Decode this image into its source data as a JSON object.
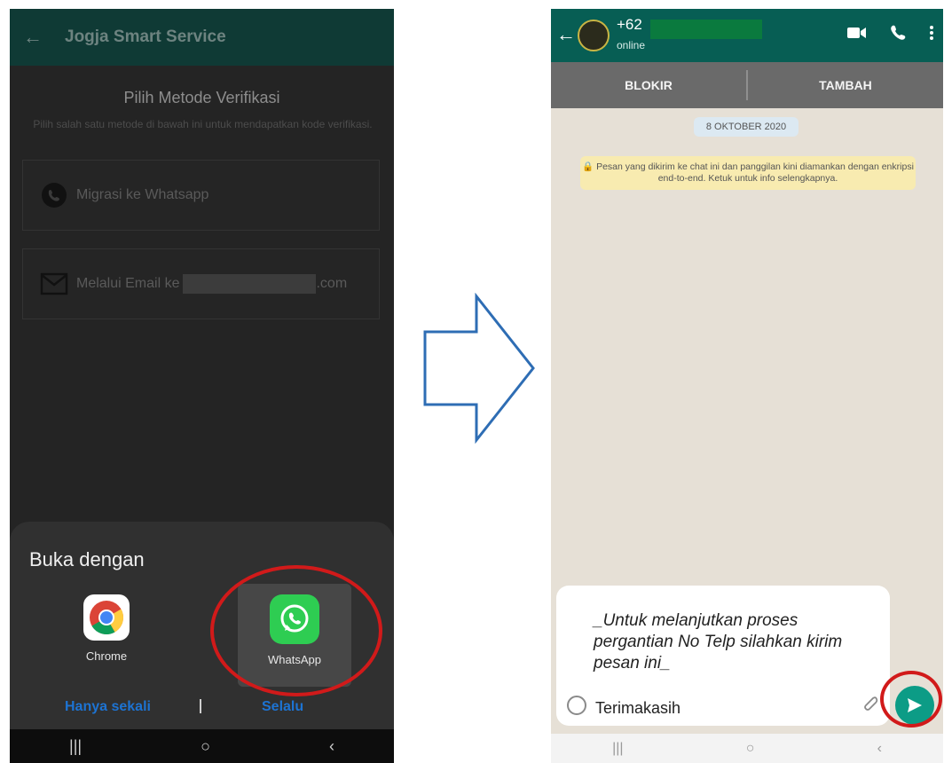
{
  "left_screen": {
    "app_title": "Jogja Smart Service",
    "heading": "Pilih Metode Verifikasi",
    "subheading": "Pilih salah satu metode di bawah ini untuk mendapatkan kode verifikasi.",
    "options": [
      {
        "label": "Migrasi ke Whatsapp",
        "icon": "whatsapp-icon"
      },
      {
        "label": "Melalui Email ke",
        "suffix": ".com",
        "icon": "mail-icon"
      }
    ],
    "sheet": {
      "title": "Buka dengan",
      "apps": [
        {
          "label": "Chrome",
          "icon": "chrome-icon"
        },
        {
          "label": "WhatsApp",
          "icon": "whatsapp-icon"
        }
      ],
      "once_label": "Hanya sekali",
      "always_label": "Selalu"
    },
    "nav": [
      "|||",
      "○",
      "‹"
    ]
  },
  "right_screen": {
    "contact_number": "+62",
    "status": "online",
    "tabs": [
      "BLOKIR",
      "TAMBAH"
    ],
    "date_chip": "8 OKTOBER 2020",
    "encryption_note": "Pesan yang dikirim ke chat ini dan panggilan kini diamankan dengan enkripsi end-to-end. Ketuk untuk info selengkapnya.",
    "compose_text": "_Untuk melanjutkan proses pergantian No Telp silahkan kirim pesan ini_",
    "compose_last_line": "Terimakasih",
    "nav": [
      "|||",
      "○",
      "‹"
    ]
  },
  "colors": {
    "whatsapp_green": "#2ecd52",
    "whatsapp_header": "#075e54",
    "highlight_red": "#d11a1a",
    "arrow_blue": "#2e6db4",
    "button_blue": "#1d73d2"
  }
}
